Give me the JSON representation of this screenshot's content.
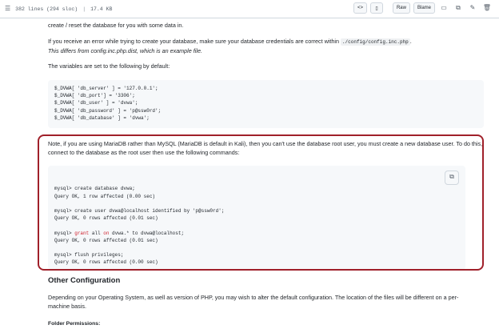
{
  "toolbar": {
    "lines_info": "382 lines (294 sloc)",
    "size": "17.4 KB",
    "raw": "Raw",
    "blame": "Blame"
  },
  "content": {
    "para1": "create / reset the database for you with some data in.",
    "para2a": "If you receive an error while trying to create your database, make sure your database credentials are correct within",
    "para2_code": "./config/config.inc.php",
    "para2b": ".",
    "para2_italic": "This differs from config.inc.php.dist, which is an example file.",
    "para3": "The variables are set to the following by default:",
    "code1": [
      "$_DVWA[ 'db_server' ] = '127.0.0.1';",
      "$_DVWA[ 'db_port'] = '3306';",
      "$_DVWA[ 'db_user' ] = 'dvwa';",
      "$_DVWA[ 'db_password' ] = 'p@ssw0rd';",
      "$_DVWA[ 'db_database' ] = 'dvwa';"
    ],
    "para4": "Note, if you are using MariaDB rather than MySQL (MariaDB is default in Kali), then you can't use the database root user, you must create a new database user. To do this, connect to the database as the root user then use the following commands:",
    "code2": {
      "l1": "mysql> create database dvwa;",
      "l2": "Query OK, 1 row affected (0.00 sec)",
      "l3": "mysql> create user dvwa@localhost identified by 'p@ssw0rd';",
      "l4": "Query OK, 0 rows affected (0.01 sec)",
      "l5_prefix": "mysql> ",
      "l5_kw1": "grant",
      "l5_mid": " all ",
      "l5_kw2": "on",
      "l5_rest": " dvwa.* to dvwa@localhost;",
      "l6": "Query OK, 0 rows affected (0.01 sec)",
      "l7": "mysql> flush privileges;",
      "l8": "Query OK, 0 rows affected (0.00 sec)"
    },
    "heading": "Other Configuration",
    "para5": "Depending on your Operating System, as well as version of PHP, you may wish to alter the default configuration. The location of the files will be different on a per-machine basis.",
    "para6": "Folder Permissions:"
  }
}
